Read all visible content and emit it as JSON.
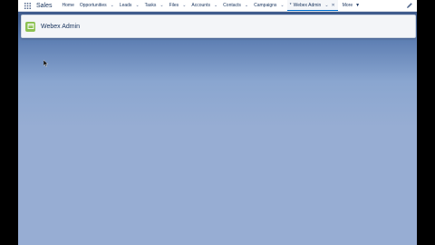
{
  "navbar": {
    "app_name": "Sales",
    "items": [
      {
        "label": "Home",
        "has_dropdown": false
      },
      {
        "label": "Opportunities",
        "has_dropdown": true
      },
      {
        "label": "Leads",
        "has_dropdown": true
      },
      {
        "label": "Tasks",
        "has_dropdown": true
      },
      {
        "label": "Files",
        "has_dropdown": true
      },
      {
        "label": "Accounts",
        "has_dropdown": true
      },
      {
        "label": "Contacts",
        "has_dropdown": true
      },
      {
        "label": "Campaigns",
        "has_dropdown": true
      }
    ],
    "active_tab": {
      "label": "Webex Admin"
    },
    "more_label": "More",
    "icons": {
      "app_launcher": "grid-icon",
      "chevron": "chevron-down-icon",
      "close": "close-icon",
      "edit": "pencil-icon"
    }
  },
  "header": {
    "title": "Webex Admin",
    "icon": "webex-tab-icon",
    "icon_color": "#8cc152"
  },
  "colors": {
    "nav_text": "#16325c",
    "active_underline": "#0070d2",
    "background": "#97add3"
  }
}
